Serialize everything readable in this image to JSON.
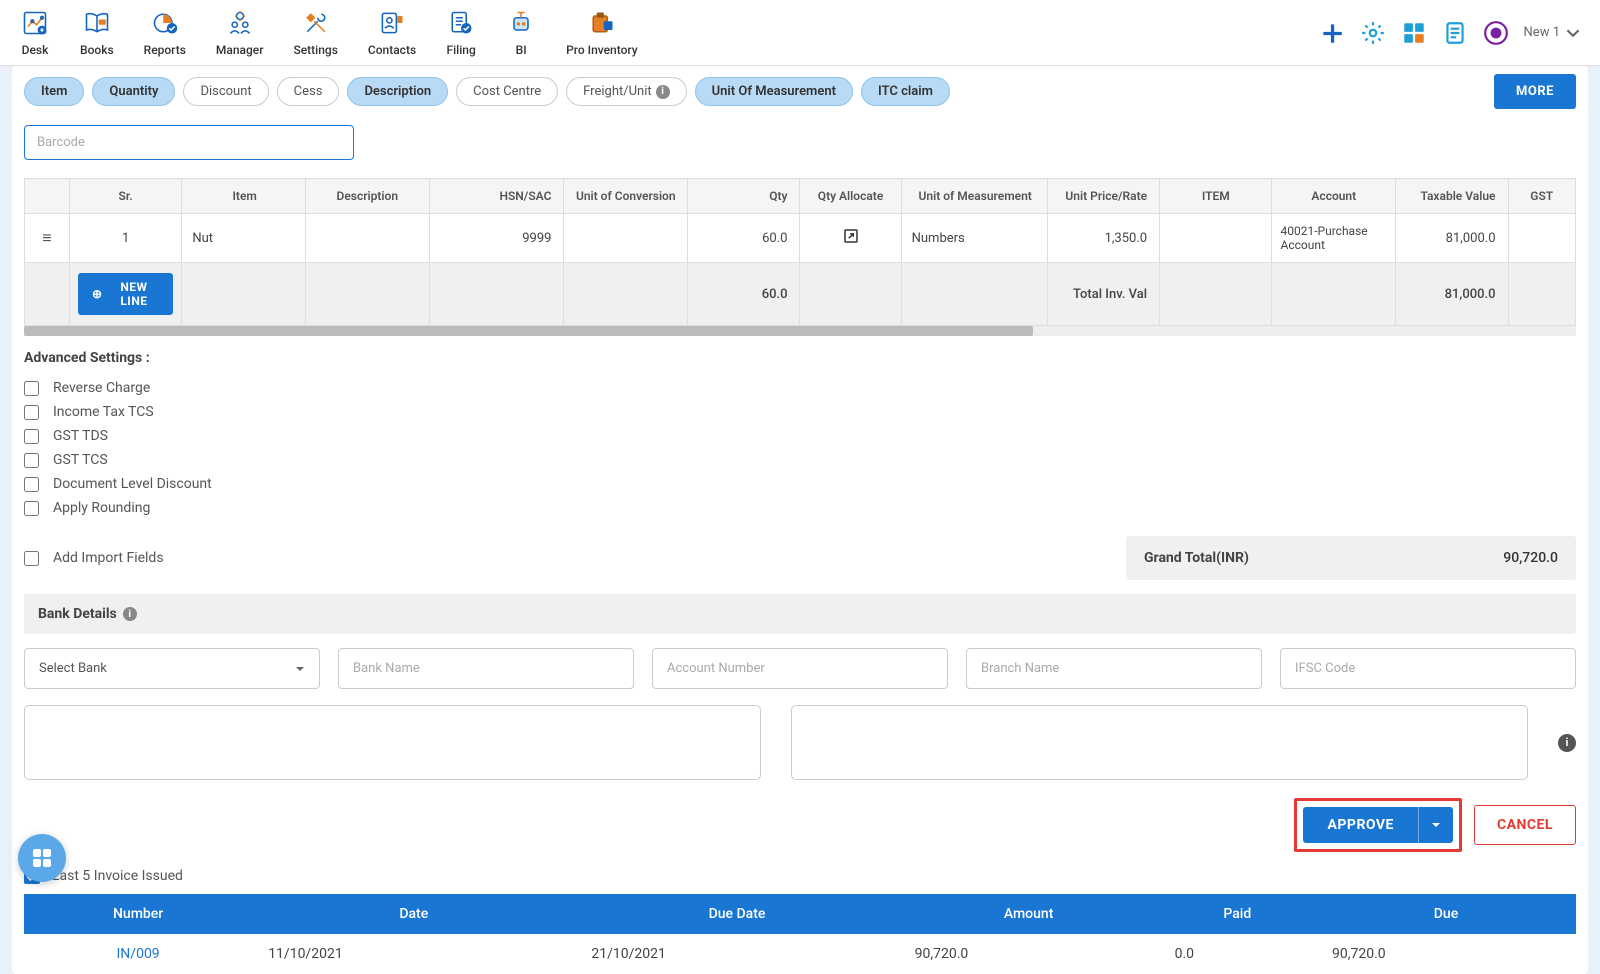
{
  "topnav": {
    "items": [
      "Desk",
      "Books",
      "Reports",
      "Manager",
      "Settings",
      "Contacts",
      "Filing",
      "BI",
      "Pro Inventory"
    ],
    "new_label": "New 1"
  },
  "chips": [
    {
      "label": "Item",
      "active": true
    },
    {
      "label": "Quantity",
      "active": true
    },
    {
      "label": "Discount",
      "active": false
    },
    {
      "label": "Cess",
      "active": false
    },
    {
      "label": "Description",
      "active": true
    },
    {
      "label": "Cost Centre",
      "active": false
    },
    {
      "label": "Freight/Unit",
      "active": false,
      "info": true
    },
    {
      "label": "Unit Of Measurement",
      "active": true
    },
    {
      "label": "ITC claim",
      "active": true
    }
  ],
  "more_btn": "MORE",
  "barcode_placeholder": "Barcode",
  "table": {
    "headers": [
      "Sr.",
      "Item",
      "Description",
      "HSN/SAC",
      "Unit of Conversion",
      "Qty",
      "Qty Allocate",
      "Unit of Measurement",
      "Unit Price/Rate",
      "ITEM",
      "Account",
      "Taxable Value",
      "GST"
    ],
    "row": {
      "sr": "1",
      "item": "Nut",
      "description": "",
      "hsn": "9999",
      "uoc": "",
      "qty": "60.0",
      "uom": "Numbers",
      "price": "1,350.0",
      "itemcol": "",
      "account": "40021-Purchase Account",
      "taxval": "81,000.0",
      "gst": ""
    },
    "newline_btn": "NEW LINE",
    "totals": {
      "qty": "60.0",
      "label": "Total Inv. Val",
      "taxval": "81,000.0"
    }
  },
  "advanced": {
    "title": "Advanced Settings :",
    "options": [
      "Reverse Charge",
      "Income Tax TCS",
      "GST TDS",
      "GST TCS",
      "Document Level Discount",
      "Apply Rounding"
    ],
    "import_fields": "Add Import Fields"
  },
  "grand_total": {
    "label": "Grand Total(INR)",
    "value": "90,720.0"
  },
  "bank": {
    "title": "Bank Details",
    "select_placeholder": "Select Bank",
    "name_placeholder": "Bank Name",
    "account_placeholder": "Account Number",
    "branch_placeholder": "Branch Name",
    "ifsc_placeholder": "IFSC Code"
  },
  "actions": {
    "approve": "APPROVE",
    "cancel": "CANCEL"
  },
  "last5": {
    "label": "Last 5 Invoice Issued",
    "headers": [
      "Number",
      "Date",
      "Due Date",
      "Amount",
      "Paid",
      "Due"
    ],
    "row": {
      "number": "IN/009",
      "date": "11/10/2021",
      "due_date": "21/10/2021",
      "amount": "90,720.0",
      "paid": "0.0",
      "due": "90,720.0"
    }
  }
}
